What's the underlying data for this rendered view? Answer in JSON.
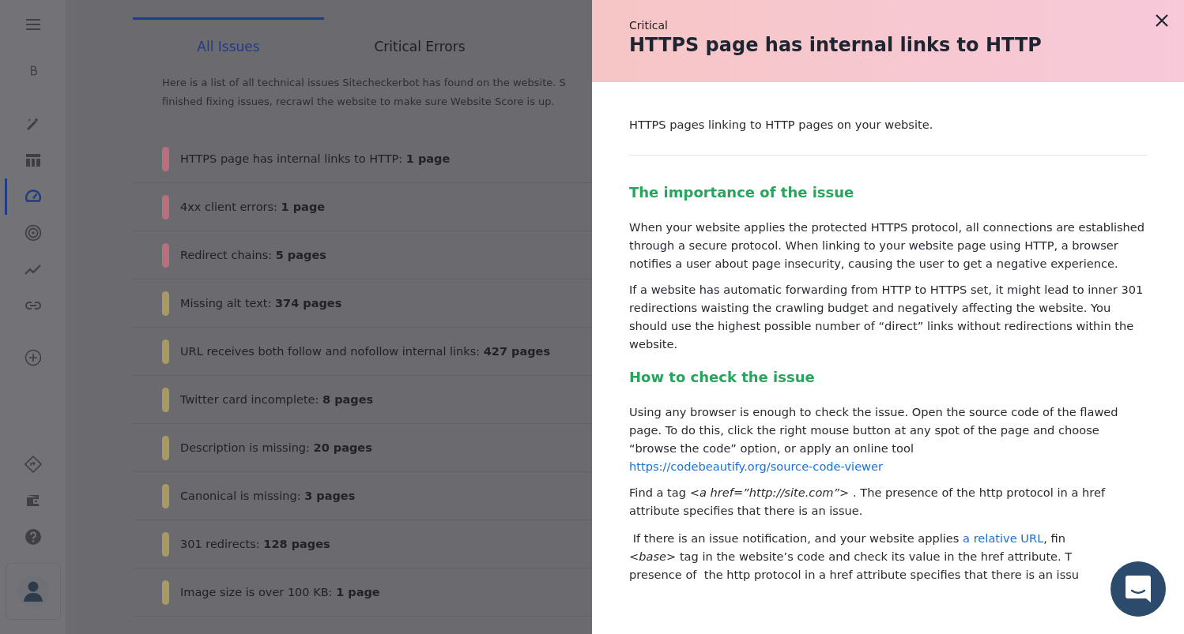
{
  "sidebar": {
    "items": [
      {
        "selected": false
      },
      {
        "selected": false
      },
      {
        "selected": false
      },
      {
        "selected": false
      },
      {
        "selected": true
      },
      {
        "selected": false
      },
      {
        "selected": false
      },
      {
        "selected": false
      },
      {
        "selected": false
      }
    ]
  },
  "tabs": [
    {
      "label": "All Issues",
      "selected": true
    },
    {
      "label": "Critical Errors",
      "selected": false
    }
  ],
  "intro_lines": [
    "Here is a list of all technical issues Sitecheckerbot has found on the website. S",
    "finished fixing issues, recrawl the website to make sure Website Score is up."
  ],
  "issues": [
    {
      "text": "HTTPS page has internal links to HTTP: **1 page**",
      "color": "#b9707e"
    },
    {
      "text": "4xx client errors: **1 page**",
      "color": "#b9707e"
    },
    {
      "text": "Redirect chains: **5 pages**",
      "color": "#b9707e"
    },
    {
      "text": "Missing alt text: **374 pages**",
      "color": "#a89a62"
    },
    {
      "text": "URL receives both follow and nofollow internal links: **427 pages**",
      "color": "#a89a62"
    },
    {
      "text": "Twitter card incomplete: **8 pages**",
      "color": "#a89a62"
    },
    {
      "text": "Description is missing: **20 pages**",
      "color": "#a89a62"
    },
    {
      "text": "Canonical is missing: **3 pages**",
      "color": "#a89a62"
    },
    {
      "text": "301 redirects: **128 pages**",
      "color": "#a89a62"
    },
    {
      "text": "Image size is over 100 KB: **1 page**",
      "color": "#a89a62"
    }
  ],
  "panel": {
    "severity": "Critical",
    "title": "HTTPS page has internal links to HTTP",
    "summary": "HTTPS pages linking to HTTP pages on your website.",
    "sections": [
      {
        "heading": "The importance of the issue",
        "paragraphs": [
          [
            {
              "kind": "text",
              "text": "When your website applies the protected HTTPS protocol, all connections are established through a secure protocol. When linking to your website page using HTTP, a browser notifies a user about page insecurity, causing the user to get a negative experience."
            }
          ],
          [
            {
              "kind": "text",
              "text": "If a website has automatic forwarding from HTTP to HTTPS set, it might lead to inner 301 redirections waisting the crawling budget and negatively affecting the website. You should use the highest possible number of “direct” links without redirections within the website."
            }
          ]
        ]
      },
      {
        "heading": "How to check the issue",
        "paragraphs": [
          [
            {
              "kind": "text",
              "text": "Using any browser is enough to check the issue. Open the source code of the flawed page. To do this, click the right mouse button at any spot of the page and choose “browse the code” option, or apply an online tool "
            },
            {
              "kind": "link",
              "text": "https://codebeautify.org/source-code-viewer"
            }
          ],
          [
            {
              "kind": "text",
              "text": "Find a tag *<a href=”http://site.com”>*  . The presence of  the http protocol in a href attribute specifies that there is an issue."
            }
          ]
        ]
      }
    ],
    "last_lines": [
      [
        {
          "kind": "text",
          "text": " If there is an issue notification, and your website applies "
        },
        {
          "kind": "link",
          "text": "a relative URL"
        },
        {
          "kind": "text",
          "text": ", fin"
        }
      ],
      [
        {
          "kind": "text",
          "text": "*<base>* tag in the website’s code and check its value in the href attribute. T"
        }
      ],
      [
        {
          "kind": "text",
          "text": "presence of  the http protocol in a href attribute specifies that there is an issu"
        }
      ]
    ]
  }
}
